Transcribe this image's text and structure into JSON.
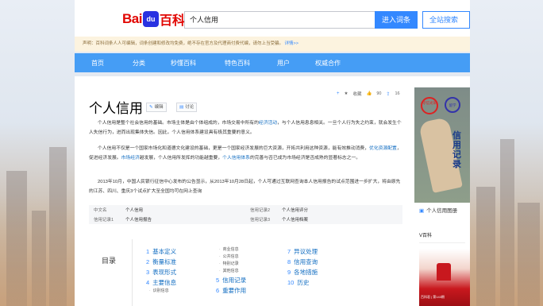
{
  "header": {
    "logo_text_left": "Bai",
    "logo_paw": "du",
    "logo_text_right": "百科",
    "search_value": "个人信用",
    "enter_button": "进入词条",
    "all_search_button": "全站搜索"
  },
  "notice": {
    "text": "声明：百科词条人人可编辑，词条创建和修改均免费，绝不存在官方及代理商付费代编，请勿上当受骗。",
    "more": "详情>>"
  },
  "nav": {
    "items": [
      "首页",
      "分类",
      "秒懂百科",
      "特色百科",
      "用户",
      "权威合作"
    ]
  },
  "article": {
    "title": "个人信用",
    "edit_label": "编辑",
    "discuss_label": "讨论",
    "toolbar": {
      "add": "+",
      "collect_label": "收藏",
      "like_count": "90",
      "share_count": "16"
    },
    "p1_a": "个人信用是整个社会信用的基础。市场主体是由个体组成的，市场交易中所有的",
    "p1_link": "经济活动",
    "p1_b": "，与个人信用息息相关。一旦个人行为失之约束，就会发生个人失信行为，进而出现集体失信。因此，个人信用体系建设具有极其重要的意义。",
    "p2_a": "个人信用不仅是一个国家市场化和道德文化建设的基础，更是一个国家经济发展的巨大资源，开拓共利用这种资源，能有效推动消费，",
    "p2_link1": "优化资源配置",
    "p2_b": "，促进经济发展。",
    "p2_link2": "市场经济",
    "p2_c": "越发展，个人信用所发挥的功能越重要，",
    "p2_link3": "个人信用体系",
    "p2_d": "的完善与否已成为市场经济是否成熟的显著标志之一。",
    "p3": "2013年10月，中国人民银行征信中心发布的公告显示，从2013年10月28日起，个人可通过互联网查询本人信用报告的试点范围进一步扩大，将由原先的江苏、四川、重庆3个试点扩大至全国均可在网上查询"
  },
  "basic_info": {
    "rows": [
      {
        "k1": "中文名",
        "v1": "个人信用",
        "k2": "信用记录2",
        "v2": "个人信用评分"
      },
      {
        "k1": "信用记录1",
        "v1": "个人信用报告",
        "k2": "信用记录3",
        "v2": "个人信用档案"
      }
    ]
  },
  "toc": {
    "title": "目录",
    "col1": [
      {
        "n": "1",
        "t": "基本定义"
      },
      {
        "n": "2",
        "t": "衡量标准"
      },
      {
        "n": "3",
        "t": "表现形式"
      },
      {
        "n": "4",
        "t": "主要信息"
      }
    ],
    "col1_sub": "识别信息",
    "col2_subs": [
      "商业信息",
      "公共信息",
      "特别记录",
      "其他信息"
    ],
    "col2": [
      {
        "n": "5",
        "t": "信用记录"
      },
      {
        "n": "6",
        "t": "重要作用"
      }
    ],
    "col3": [
      {
        "n": "7",
        "t": "异议处理"
      },
      {
        "n": "8",
        "t": "信用查询"
      },
      {
        "n": "9",
        "t": "各地措施"
      },
      {
        "n": "10",
        "t": "历史"
      }
    ]
  },
  "side": {
    "stamp1": "守信光荣",
    "stamp2": "留学",
    "vertical_text": "信用记录",
    "caption": "个人信用图册",
    "vbox_title": "V百科",
    "vthumb_caption": "百科君 | 第143期"
  }
}
